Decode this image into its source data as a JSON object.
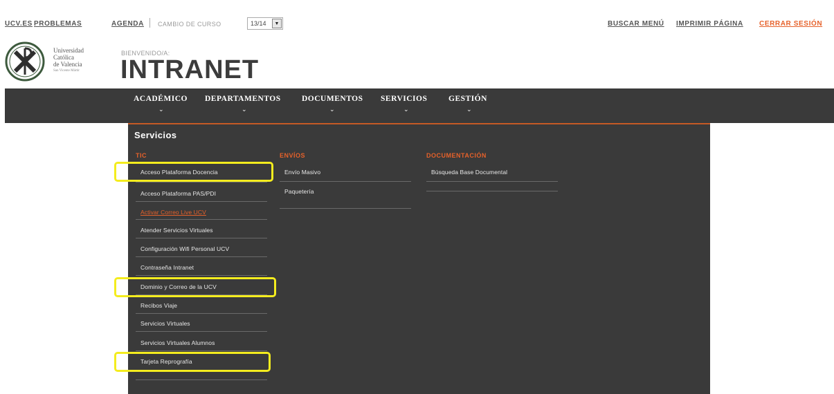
{
  "topbar": {
    "links": [
      "UCV.ES",
      "PROBLEMAS",
      "AGENDA"
    ],
    "curso_label": "CAMBIO DE CURSO",
    "curso_value": "13/14",
    "right_links": [
      "BUSCAR MENÚ",
      "IMPRIMIR PÁGINA",
      "CERRAR SESIÓN"
    ]
  },
  "logo": {
    "line1": "Universidad",
    "line2": "Católica",
    "line3": "de Valencia",
    "line4": "San Vicente Mártir"
  },
  "header": {
    "welcome": "BIENVENIDO/A:",
    "title": "INTRANET"
  },
  "nav": {
    "items": [
      "ACADÉMICO",
      "DEPARTAMENTOS",
      "DOCUMENTOS",
      "SERVICIOS",
      "GESTIÓN"
    ],
    "chevron": "⌄"
  },
  "menu": {
    "title": "Servicios",
    "col1_head": "TIC",
    "col1": [
      "Acceso Plataforma Docencia",
      "Acceso Plataforma PAS/PDI",
      "Activar Correo Live UCV",
      "Atender Servicios Virtuales",
      "Configuración Wifi Personal UCV",
      "Contraseña Intranet",
      "Dominio y Correo de la UCV",
      "Recibos Viaje",
      "Servicios Virtuales",
      "Servicios Virtuales Alumnos",
      "Tarjeta Reprografía"
    ],
    "col2_head": "ENVÍOS",
    "col2": [
      "Envío Masivo",
      "Paquetería"
    ],
    "col3_head": "DOCUMENTACIÓN",
    "col3": [
      "Búsqueda Base Documental"
    ]
  },
  "colors": {
    "accent": "#e6612a",
    "nav_bg": "#3a3a3a",
    "highlight": "#f4ec1e"
  }
}
